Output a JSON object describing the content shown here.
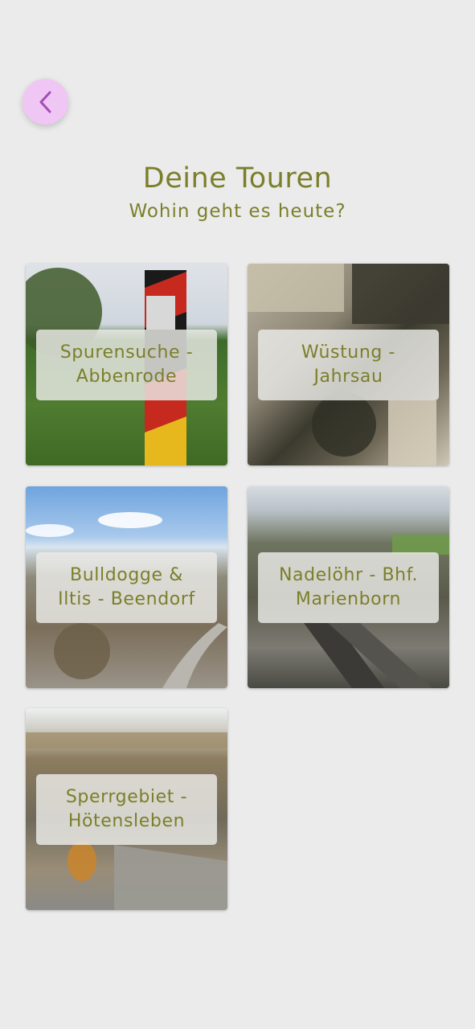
{
  "header": {
    "title": "Deine Touren",
    "subtitle": "Wohin geht es heute?"
  },
  "back_button": {
    "icon": "chevron-left-icon"
  },
  "colors": {
    "accent": "#7b7f2a",
    "back_button_bg": "#f0c6f5",
    "back_chevron": "#a14fb5",
    "background": "#ebebeb"
  },
  "tours": [
    {
      "label": "Spurensuche -\nAbbenrode"
    },
    {
      "label": "Wüstung -\nJahrsau"
    },
    {
      "label": "Bulldogge &\nIltis - Beendorf"
    },
    {
      "label": "Nadelöhr - Bhf.\nMarienborn"
    },
    {
      "label": "Sperrgebiet -\nHötensleben"
    }
  ]
}
